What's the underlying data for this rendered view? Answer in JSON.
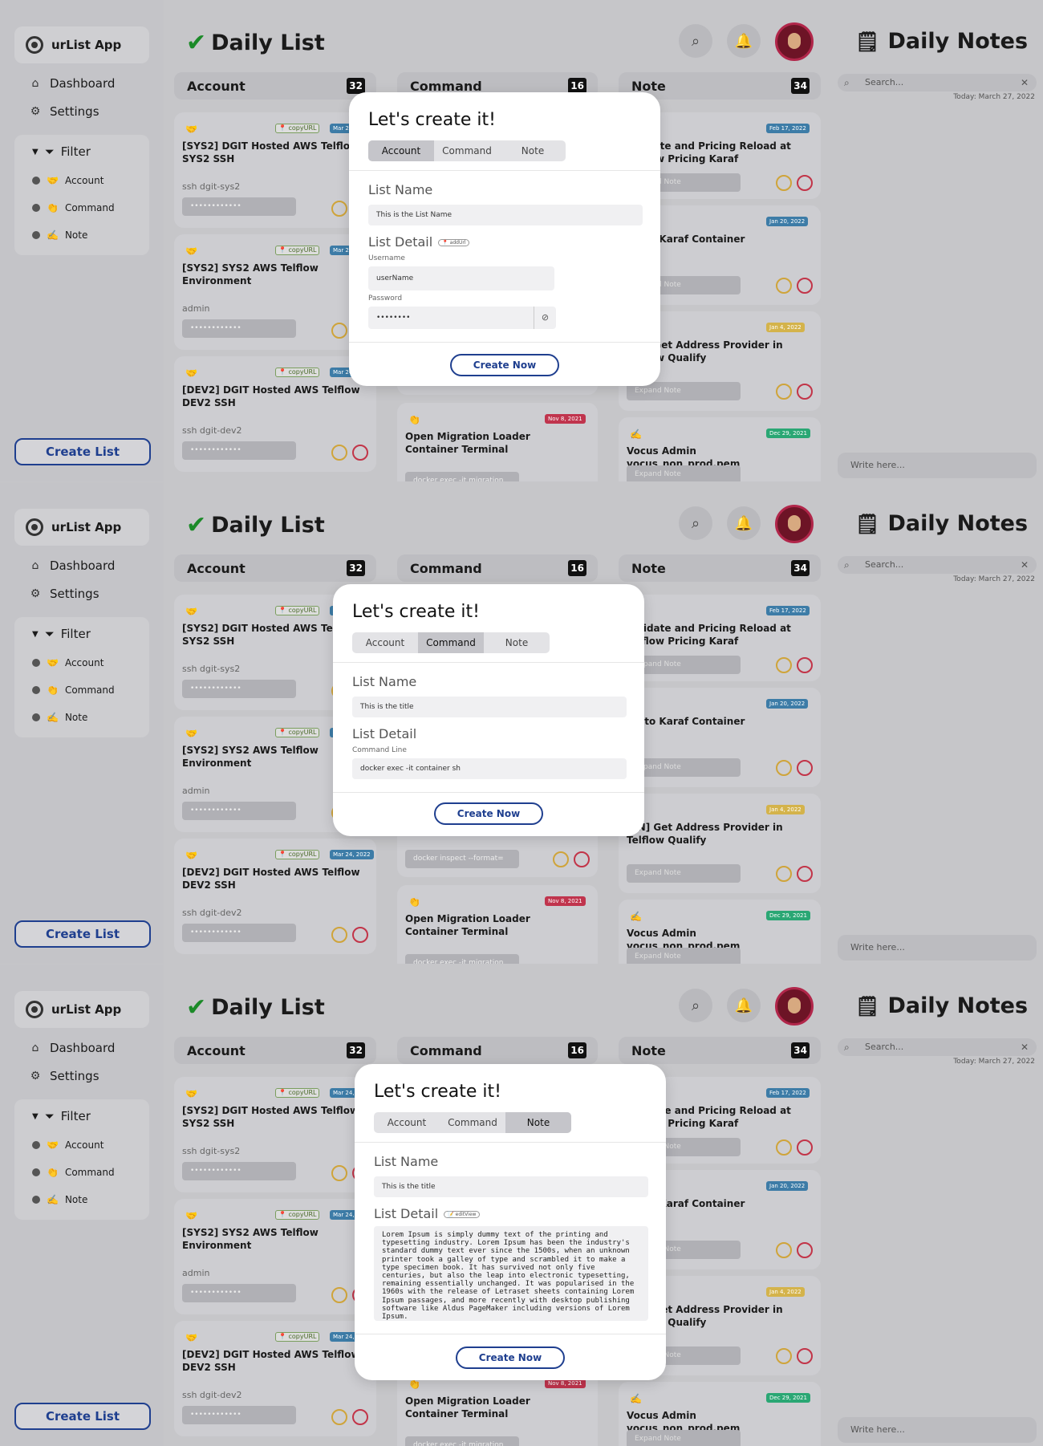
{
  "app": {
    "name": "urList App"
  },
  "nav": {
    "dashboard": "Dashboard",
    "settings": "Settings",
    "filter": "Filter"
  },
  "filters": [
    {
      "emoji": "🤝",
      "label": "Account"
    },
    {
      "emoji": "👏",
      "label": "Command"
    },
    {
      "emoji": "✍️",
      "label": "Note"
    }
  ],
  "create_list_label": "Create List",
  "main": {
    "title": "Daily List"
  },
  "columns": {
    "account": {
      "label": "Account",
      "count": "32"
    },
    "command": {
      "label": "Command",
      "count": "16"
    },
    "note": {
      "label": "Note",
      "count": "34"
    }
  },
  "account_cards": [
    {
      "emoji": "🤝",
      "tag": "📍 copyURL",
      "date": "Mar 24, 2022",
      "title": "[SYS2] DGIT Hosted AWS Telflow SYS2 SSH",
      "sub": "ssh dgit-sys2",
      "masked": "••••••••••••"
    },
    {
      "emoji": "🤝",
      "tag": "📍 copyURL",
      "date": "Mar 24, 2022",
      "title": "[SYS2] SYS2 AWS Telflow Environment",
      "sub": "admin",
      "masked": "••••••••••••"
    },
    {
      "emoji": "🤝",
      "tag": "📍 copyURL",
      "date": "Mar 24, 2022",
      "title": "[DEV2] DGIT Hosted AWS Telflow DEV2 SSH",
      "sub": "ssh dgit-dev2",
      "masked": "••••••••••••"
    }
  ],
  "command_cards": [
    {
      "emoji": "👏",
      "date": "Nov 8, 2021",
      "title": "Open Migration Loader Container Terminal",
      "sub": "docker exec -it migration",
      "field": "docker inspect --format="
    }
  ],
  "note_cards": [
    {
      "date": "Feb 17, 2022",
      "title": "Validate and Pricing Reload at Telflow Pricing Karaf",
      "btn": "Expand Note"
    },
    {
      "date": "Jan 20, 2022",
      "title": "Go to Karaf Container",
      "btn": "Expand Note"
    },
    {
      "date": "Jan 4, 2022",
      "title": "[TN] Get Address Provider in Telflow Qualify",
      "btn": "Expand Note"
    },
    {
      "emoji": "✍️",
      "date": "Dec 29, 2021",
      "title": "Vocus Admin vocus_non_prod.pem",
      "btn": "Expand Note"
    }
  ],
  "notes_panel": {
    "title": "Daily Notes",
    "search_placeholder": "Search...",
    "today": "Today: March 27, 2022",
    "write_placeholder": "Write here..."
  },
  "modal": {
    "title": "Let's create it!",
    "tabs": [
      "Account",
      "Command",
      "Note"
    ],
    "list_name_label": "List Name",
    "list_detail_label": "List Detail",
    "create_now": "Create Now",
    "account": {
      "list_name_value": "This is the List Name",
      "addUrl": "📍 addUrl",
      "username_label": "Username",
      "username_value": "userName",
      "password_label": "Password",
      "password_value": "••••••••"
    },
    "command": {
      "list_name_value": "This is the title",
      "command_label": "Command Line",
      "command_value": "docker exec -it container sh"
    },
    "note": {
      "list_name_value": "This is the title",
      "editview": "📝 editView",
      "body": "Lorem Ipsum is simply dummy text of the printing and typesetting industry. Lorem Ipsum has been the industry's standard dummy text ever since the 1500s, when an unknown printer took a galley of type and scrambled it to make a type specimen book. It has survived not only five centuries, but also the leap into electronic typesetting, remaining essentially unchanged. It was popularised in the 1960s with the release of Letraset sheets containing Lorem Ipsum passages, and more recently with desktop publishing software like Aldus PageMaker including versions of Lorem Ipsum."
    }
  },
  "colors": {
    "accent": "#1f3f8f",
    "check": "#1b8a28",
    "date_blue": "#3d7ca7",
    "date_red": "#c0344d",
    "date_yellow": "#d4b34b",
    "date_green": "#2aa774"
  }
}
